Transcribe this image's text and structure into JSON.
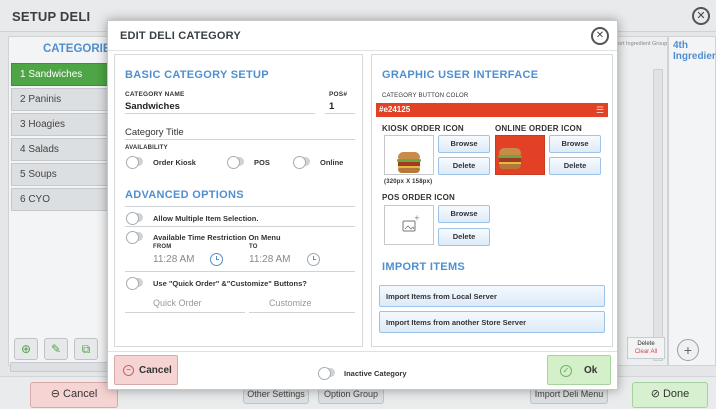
{
  "window": {
    "title": "SETUP DELI",
    "close_glyph": "✕"
  },
  "categories": {
    "header": "CATEGORIES",
    "items": [
      "1 Sandwiches",
      "2 Paninis",
      "3 Hoagies",
      "4 Salads",
      "5 Soups",
      "6 CYO"
    ],
    "active_index": 0
  },
  "right_panel": {
    "col_header": "port Ingredient Group",
    "next_header": "4th Ingredier",
    "delete_label": "Delete",
    "clear_all_label": "Clear All"
  },
  "bottom_bar": {
    "cancel_label": "Cancel",
    "other_settings_label": "Other Settings",
    "option_group_label": "Option Group",
    "import_deli_menu_label": "Import Deli Menu",
    "done_label": "Done"
  },
  "modal": {
    "title": "EDIT DELI CATEGORY",
    "close_glyph": "✕",
    "basic": {
      "title": "BASIC CATEGORY SETUP",
      "category_name_label": "CATEGORY NAME",
      "category_name_value": "Sandwiches",
      "pos_label": "POS#",
      "pos_value": "1",
      "category_title_label": "Category Title",
      "availability_label": "AVAILABILITY",
      "order_kiosk_label": "Order Kiosk",
      "pos_toggle_label": "POS",
      "online_label": "Online"
    },
    "advanced": {
      "title": "ADVANCED OPTIONS",
      "multiple_selection_label": "Allow Multiple Item Selection.",
      "time_restriction_label": "Available Time Restriction On Menu",
      "from_label": "FROM",
      "from_value": "11:28 AM",
      "to_label": "TO",
      "to_value": "11:28 AM",
      "quick_order_toggle_label": "Use \"Quick Order\" &\"Customize\" Buttons?",
      "quick_order_placeholder": "Quick Order",
      "customize_placeholder": "Customize"
    },
    "gui": {
      "title": "GRAPHIC USER INTERFACE",
      "button_color_label": "CATEGORY BUTTON COLOR",
      "button_color_value": "#e24125",
      "button_color_hex": "#e24125",
      "kiosk_label": "KIOSK ORDER ICON",
      "online_label": "ONLINE ORDER ICON",
      "browse_label": "Browse",
      "delete_label": "Delete",
      "size_note": "(320px X 158px)",
      "pos_icon_label": "POS ORDER ICON"
    },
    "import": {
      "title": "IMPORT ITEMS",
      "local_label": "Import Items from Local Server",
      "store_label": "Import Items from another Store Server"
    },
    "footer": {
      "cancel_label": "Cancel",
      "inactive_label": "Inactive Category",
      "ok_label": "Ok"
    }
  },
  "colors": {
    "accent": "#4f8fd0",
    "active_green": "#4ea545",
    "category_red": "#e24125"
  }
}
